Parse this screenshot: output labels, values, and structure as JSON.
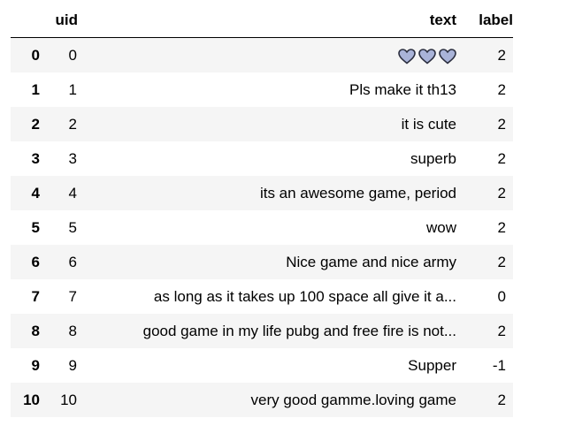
{
  "table": {
    "columns": {
      "index": "",
      "uid": "uid",
      "text": "text",
      "label": "label"
    },
    "rows": [
      {
        "index": "0",
        "uid": "0",
        "text": "",
        "text_icons": [
          "heart-icon",
          "heart-icon",
          "heart-icon"
        ],
        "label": "2"
      },
      {
        "index": "1",
        "uid": "1",
        "text": "Pls make it th13",
        "label": "2"
      },
      {
        "index": "2",
        "uid": "2",
        "text": "it is cute",
        "label": "2"
      },
      {
        "index": "3",
        "uid": "3",
        "text": "superb",
        "label": "2"
      },
      {
        "index": "4",
        "uid": "4",
        "text": "its an awesome game, period",
        "label": "2"
      },
      {
        "index": "5",
        "uid": "5",
        "text": "wow",
        "label": "2"
      },
      {
        "index": "6",
        "uid": "6",
        "text": "Nice game and nice army",
        "label": "2"
      },
      {
        "index": "7",
        "uid": "7",
        "text": "as long as it takes up 100 space all give it a...",
        "label": "0"
      },
      {
        "index": "8",
        "uid": "8",
        "text": "good game in my life pubg and free fire is not...",
        "label": "2"
      },
      {
        "index": "9",
        "uid": "9",
        "text": "Supper",
        "label": "-1"
      },
      {
        "index": "10",
        "uid": "10",
        "text": "very good gamme.loving game",
        "label": "2"
      }
    ]
  },
  "colors": {
    "heart_fill": "#a9b3d8",
    "heart_stroke": "#2a2d3e",
    "row_stripe": "#f5f5f5"
  }
}
